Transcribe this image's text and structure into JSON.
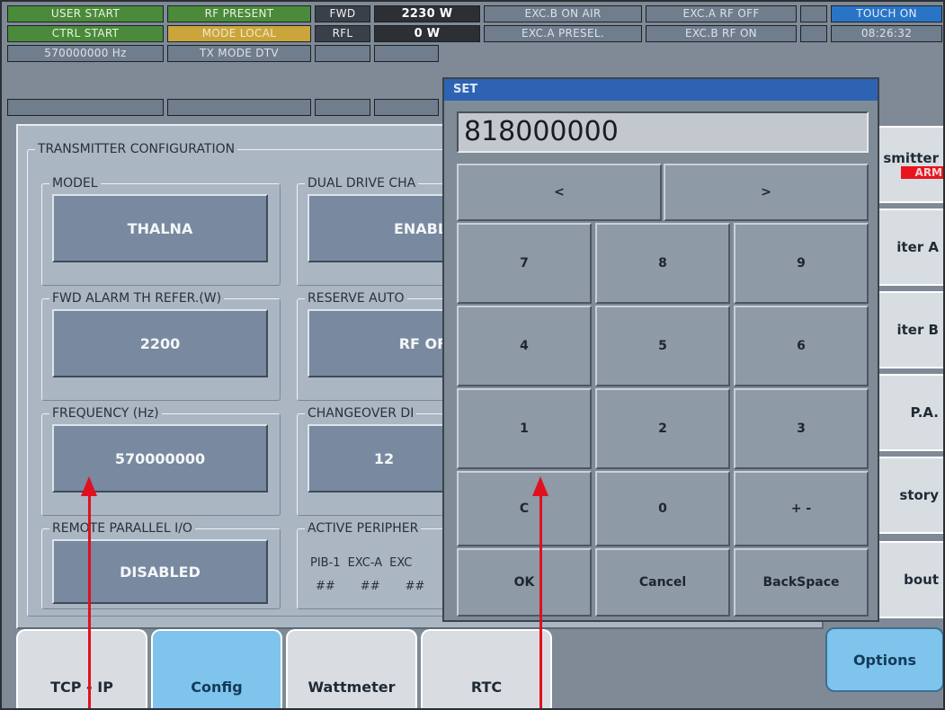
{
  "status": {
    "user_start": "USER START",
    "ctrl_start": "CTRL START",
    "freq": "570000000 Hz",
    "rf_present": "RF PRESENT",
    "mode_local": "MODE LOCAL",
    "tx_mode": "TX MODE DTV",
    "fwd_label": "FWD",
    "fwd_value": "2230 W",
    "rfl_label": "RFL",
    "rfl_value": "0 W",
    "exc_b_on_air": "EXC.B ON AIR",
    "exc_a_presel": "EXC.A PRESEL.",
    "exc_a_rf_off": "EXC.A RF OFF",
    "exc_b_rf_on": "EXC.B RF ON",
    "touch_on": "TOUCH ON",
    "time": "08:26:32"
  },
  "config": {
    "title": "TRANSMITTER CONFIGURATION",
    "model_label": "MODEL",
    "model_value": "THALNA",
    "dual_label": "DUAL DRIVE CHA",
    "dual_value": "ENABLE",
    "fwd_alarm_label": "FWD ALARM TH REFER.(W)",
    "fwd_alarm_value": "2200",
    "reserve_label": "RESERVE AUTO",
    "reserve_value": "RF OFF",
    "frequency_label": "FREQUENCY (Hz)",
    "frequency_value": "570000000",
    "changeover_label": "CHANGEOVER DI",
    "changeover_value": "12",
    "remote_label": "REMOTE PARALLEL I/O",
    "remote_value": "DISABLED",
    "active_label": "ACTIVE PERIPHER",
    "peripherals": [
      "PIB-1",
      "EXC-A",
      "EXC"
    ],
    "peripheral_values": [
      "##",
      "##",
      "##"
    ]
  },
  "right_tabs": [
    "smitter",
    "iter A",
    "iter B",
    "P.A.",
    "story",
    "bout"
  ],
  "right_alarm": "ARM",
  "bottom_tabs": [
    "TCP - IP",
    "Config",
    "Wattmeter",
    "RTC",
    "Options"
  ],
  "dialog": {
    "title": "SET",
    "value": "818000000",
    "left": "<",
    "right": ">",
    "keys": [
      "7",
      "8",
      "9",
      "4",
      "5",
      "6",
      "1",
      "2",
      "3",
      "C",
      "0",
      "+ -"
    ],
    "ok": "OK",
    "cancel": "Cancel",
    "backspace": "BackSpace"
  }
}
